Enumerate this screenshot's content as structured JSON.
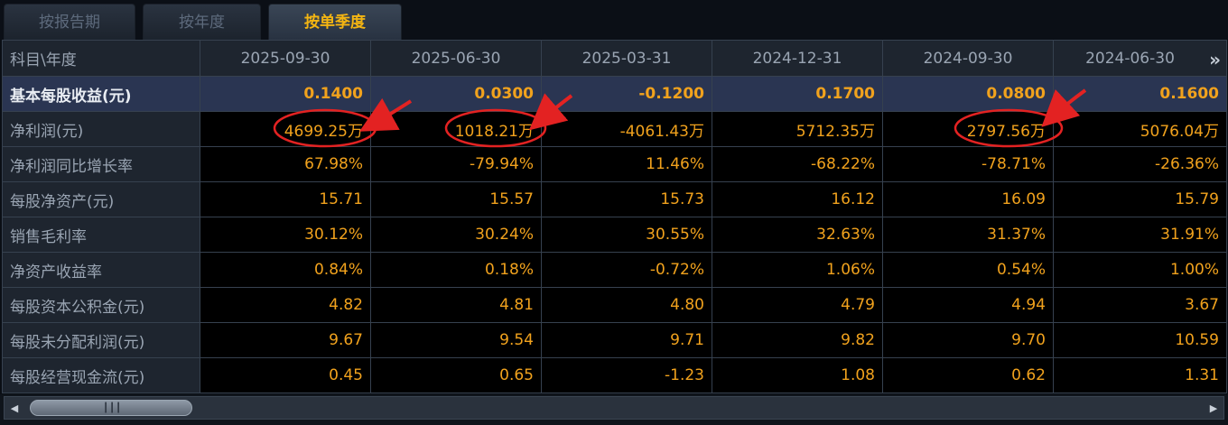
{
  "tabs": [
    {
      "label": "按报告期"
    },
    {
      "label": "按年度"
    },
    {
      "label": "按单季度"
    }
  ],
  "header": {
    "corner": "科目\\年度",
    "periods": [
      "2025-09-30",
      "2025-06-30",
      "2025-03-31",
      "2024-12-31",
      "2024-09-30",
      "2024-06-30"
    ],
    "more_icon": "double-chevron-right-icon"
  },
  "rows": [
    {
      "label": "基本每股收益(元)",
      "values": [
        "0.1400",
        "0.0300",
        "-0.1200",
        "0.1700",
        "0.0800",
        "0.1600"
      ]
    },
    {
      "label": "净利润(元)",
      "values": [
        "4699.25万",
        "1018.21万",
        "-4061.43万",
        "5712.35万",
        "2797.56万",
        "5076.04万"
      ]
    },
    {
      "label": "净利润同比增长率",
      "values": [
        "67.98%",
        "-79.94%",
        "11.46%",
        "-68.22%",
        "-78.71%",
        "-26.36%"
      ]
    },
    {
      "label": "每股净资产(元)",
      "values": [
        "15.71",
        "15.57",
        "15.73",
        "16.12",
        "16.09",
        "15.79"
      ]
    },
    {
      "label": "销售毛利率",
      "values": [
        "30.12%",
        "30.24%",
        "30.55%",
        "32.63%",
        "31.37%",
        "31.91%"
      ]
    },
    {
      "label": "净资产收益率",
      "values": [
        "0.84%",
        "0.18%",
        "-0.72%",
        "1.06%",
        "0.54%",
        "1.00%"
      ]
    },
    {
      "label": "每股资本公积金(元)",
      "values": [
        "4.82",
        "4.81",
        "4.80",
        "4.79",
        "4.94",
        "3.67"
      ]
    },
    {
      "label": "每股未分配利润(元)",
      "values": [
        "9.67",
        "9.54",
        "9.71",
        "9.82",
        "9.70",
        "10.59"
      ]
    },
    {
      "label": "每股经营现金流(元)",
      "values": [
        "0.45",
        "0.65",
        "-1.23",
        "1.08",
        "0.62",
        "1.31"
      ]
    }
  ],
  "colors": {
    "accent": "#f4b512",
    "value": "#f1a21d",
    "annotation": "#e32222"
  },
  "scrollbar": {
    "left_icon": "arrow-left-icon",
    "right_icon": "arrow-right-icon"
  }
}
